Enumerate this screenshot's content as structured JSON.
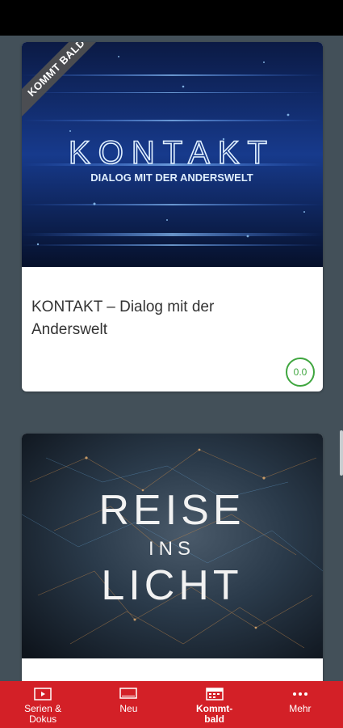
{
  "cards": [
    {
      "ribbon": "KOMMT BALD",
      "image_title": "KONTAKT",
      "image_subtitle": "DIALOG MIT DER ANDERSWELT",
      "title": "KONTAKT – Dialog mit der Anderswelt",
      "rating": "0.0"
    },
    {
      "image_line1": "REISE",
      "image_line2": "INS",
      "image_line3": "LICHT"
    }
  ],
  "nav": [
    {
      "label": "Serien &\nDokus",
      "icon": "play-icon"
    },
    {
      "label": "Neu",
      "icon": "tv-icon"
    },
    {
      "label": "Kommt-\nbald",
      "icon": "calendar-icon",
      "active": true
    },
    {
      "label": "Mehr",
      "icon": "more-dots-icon"
    }
  ],
  "colors": {
    "background": "#435059",
    "nav": "#d32027",
    "rating": "#3fa63f"
  }
}
